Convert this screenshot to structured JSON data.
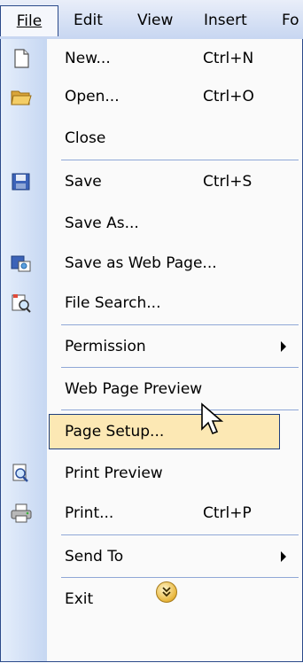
{
  "menubar": {
    "items": [
      {
        "label": "File"
      },
      {
        "label": "Edit"
      },
      {
        "label": "View"
      },
      {
        "label": "Insert"
      },
      {
        "label": "Fo"
      }
    ]
  },
  "menu": {
    "items": [
      {
        "label": "New...",
        "shortcut": "Ctrl+N",
        "icon": "new-document-icon"
      },
      {
        "label": "Open...",
        "shortcut": "Ctrl+O",
        "icon": "open-folder-icon"
      },
      {
        "label": "Close"
      },
      {
        "label": "Save",
        "shortcut": "Ctrl+S",
        "icon": "save-disk-icon"
      },
      {
        "label": "Save As..."
      },
      {
        "label": "Save as Web Page...",
        "icon": "save-web-page-icon"
      },
      {
        "label": "File Search...",
        "icon": "file-search-icon"
      },
      {
        "label": "Permission",
        "submenu": true
      },
      {
        "label": "Web Page Preview"
      },
      {
        "label": "Page Setup...",
        "highlighted": true
      },
      {
        "label": "Print Preview",
        "icon": "print-preview-icon"
      },
      {
        "label": "Print...",
        "shortcut": "Ctrl+P",
        "icon": "printer-icon"
      },
      {
        "label": "Send To",
        "submenu": true
      },
      {
        "label": "Exit"
      }
    ]
  },
  "colors": {
    "highlight": "#fce8b4",
    "border": "#2b4a8a",
    "gutter": "#c6d7f2"
  }
}
